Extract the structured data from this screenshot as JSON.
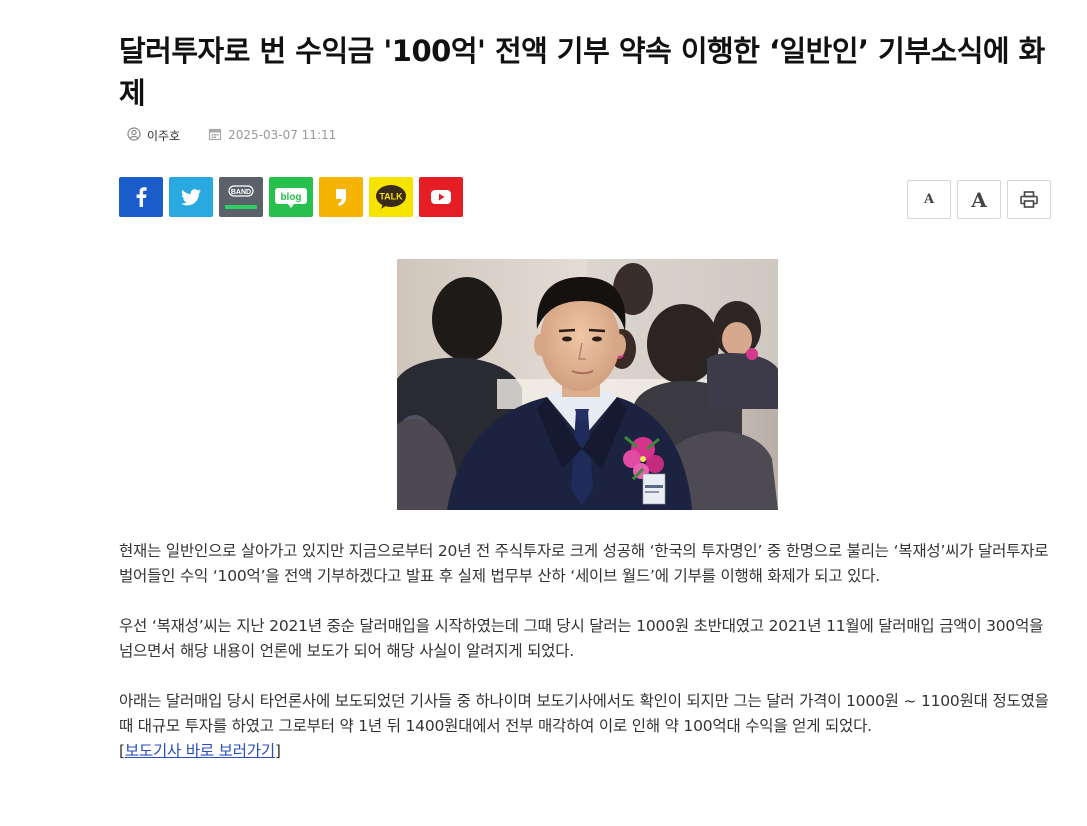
{
  "article": {
    "title": "달러투자로 번 수익금 '100억' 전액 기부 약속 이행한 ‘일반인’ 기부소식에 화제",
    "author": "이주호",
    "date": "2025-03-07 11:11"
  },
  "share": {
    "buttons": [
      {
        "name": "facebook",
        "color": "#1a5cc9"
      },
      {
        "name": "twitter",
        "color": "#2aa9e0"
      },
      {
        "name": "band",
        "label": "BAND",
        "color": "#5b6168"
      },
      {
        "name": "blog",
        "label": "blog",
        "color": "#28c04c"
      },
      {
        "name": "kakaostory",
        "color": "#f5b400"
      },
      {
        "name": "kakaotalk",
        "label": "TALK",
        "color": "#f7e300"
      },
      {
        "name": "youtube",
        "color": "#e51d24"
      }
    ]
  },
  "tools": {
    "font_small": "A",
    "font_large": "A",
    "print_icon": "print-icon"
  },
  "body": {
    "p1": "현재는 일반인으로 살아가고 있지만 지금으로부터 20년 전 주식투자로 크게 성공해 ‘한국의 투자명인’ 중 한명으로 불리는 ‘복재성’씨가 달러투자로 벌어들인 수익 ‘100억’을 전액 기부하겠다고 발표 후 실제 법무부 산하 ‘세이브 월드’에 기부를 이행해 화제가 되고 있다.",
    "p2": "우선 ‘복재성’씨는 지난 2021년 중순 달러매입을 시작하였는데 그때 당시 달러는 1000원 초반대였고 2021년 11월에 달러매입 금액이 300억을 넘으면서 해당 내용이 언론에 보도가 되어 해당 사실이 알려지게 되었다.",
    "p3": "아래는 달러매입 당시 타언론사에 보도되었던 기사들 중 하나이며 보도기사에서도 확인이 되지만 그는 달러 가격이 1000원 ~ 1100원대 정도였을 때 대규모 투자를 하였고 그로부터 약 1년 뒤 1400원대에서 전부 매각하여 이로 인해 약 100억대 수익을 얻게 되었다.",
    "link_open": "[",
    "link_text": "보도기사 바로 보러가기",
    "link_close": "]"
  }
}
